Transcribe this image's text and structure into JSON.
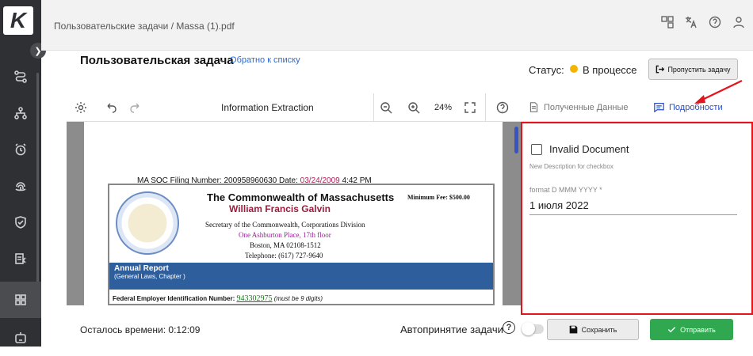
{
  "app": {
    "logo_letter": "K"
  },
  "breadcrumb": "Пользовательские задачи / Massa (1).pdf",
  "task": {
    "title": "Пользовательская задача",
    "back_link": "← Обратно к списку",
    "status_label": "Статус:",
    "status_value": "В процессе",
    "status_color": "#f4b400",
    "skip_button": "Пропустить задачу"
  },
  "viewer": {
    "title": "Information Extraction",
    "zoom": "24%"
  },
  "tabs": {
    "received": "Полученные Данные",
    "details": "Подробности"
  },
  "document": {
    "filing_prefix": "MA SOC   Filing Number: 200958960630   Date:",
    "filing_date": "03/24/2009",
    "filing_time": "4:42 PM",
    "commonwealth": "The Commonwealth of Massachusetts",
    "secretary_name": "William Francis Galvin",
    "min_fee": "Minimum Fee: $500.00",
    "division": "Secretary of the Commonwealth, Corporations Division",
    "address1": "One Ashburton Place, 17th floor",
    "address2": "Boston, MA 02108-1512",
    "phone": "Telephone: (617) 727-9640",
    "annual_report": "Annual Report",
    "general_laws": "(General Laws, Chapter )",
    "fein_label": "Federal Employer Identification Number:",
    "fein_value": "943302975",
    "fein_note": "(must be 9 digits)"
  },
  "panel": {
    "invalid_label": "Invalid Document",
    "invalid_desc": "New Description for checkbox",
    "date_label": "format D MMM YYYY *",
    "date_value": "1 июля 2022"
  },
  "footer": {
    "time_left": "Осталось времени: 0:12:09",
    "auto_accept": "Автопринятие задачи",
    "save": "Сохранить",
    "send": "Отправить"
  }
}
